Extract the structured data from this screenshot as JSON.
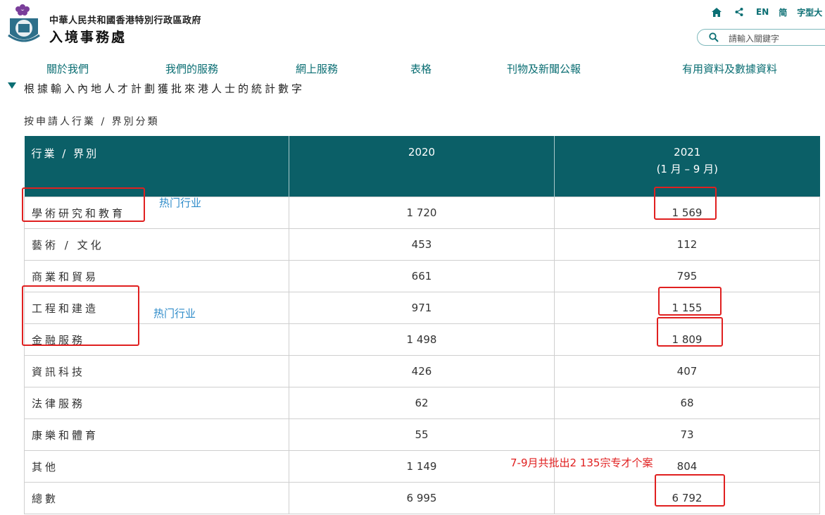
{
  "header": {
    "org_line1": "中華人民共和國香港特別行政區政府",
    "org_line2": "入境事務處",
    "lang_en": "EN",
    "lang_sc": "简",
    "font_size": "字型大",
    "search_placeholder": "請輸入關鍵字"
  },
  "nav": {
    "items": [
      {
        "label": "關於我們"
      },
      {
        "label": "我們的服務"
      },
      {
        "label": "網上服務"
      },
      {
        "label": "表格"
      },
      {
        "label": "刊物及新聞公報"
      },
      {
        "label": "有用資料及數據資料"
      }
    ]
  },
  "page": {
    "title": "根據輸入內地人才計劃獲批來港人士的統計數字",
    "subtitle": "按申請人行業 / 界別分類"
  },
  "table": {
    "headers": {
      "category": "行業 / 界別",
      "y2020": "2020",
      "y2021": "2021",
      "y2021_sub": "(1 月 – 9 月)"
    },
    "rows": [
      {
        "category": "學術研究和教育",
        "y2020": "1 720",
        "y2021": "1 569"
      },
      {
        "category": "藝術 / 文化",
        "y2020": "453",
        "y2021": "112"
      },
      {
        "category": "商業和貿易",
        "y2020": "661",
        "y2021": "795"
      },
      {
        "category": "工程和建造",
        "y2020": "971",
        "y2021": "1 155"
      },
      {
        "category": "金融服務",
        "y2020": "1 498",
        "y2021": "1 809"
      },
      {
        "category": "資訊科技",
        "y2020": "426",
        "y2021": "407"
      },
      {
        "category": "法律服務",
        "y2020": "62",
        "y2021": "68"
      },
      {
        "category": "康樂和體育",
        "y2020": "55",
        "y2021": "73"
      },
      {
        "category": "其他",
        "y2020": "1 149",
        "y2021": "804"
      },
      {
        "category": "總數",
        "y2020": "6 995",
        "y2021": "6 792"
      }
    ]
  },
  "annotations": {
    "hot_label_1": "热门行业",
    "hot_label_2": "热门行业",
    "note": "7-9月共批出2 135宗专才个案"
  },
  "colors": {
    "header_teal": "#0b5f67",
    "link_teal": "#0a6e73",
    "annotation_red": "#e02020",
    "annotation_blue": "#2e8bc9"
  }
}
